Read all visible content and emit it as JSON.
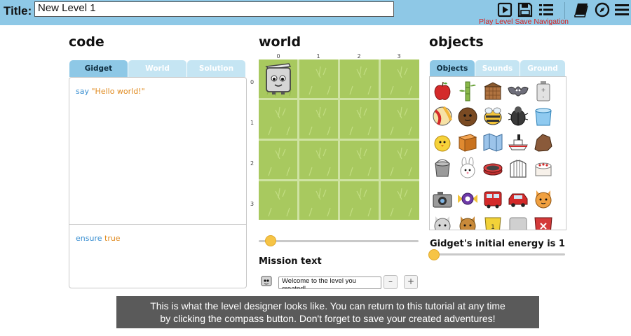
{
  "toolbar": {
    "title_label": "Title:",
    "title_value": "New Level 1",
    "play_label": "Play Level",
    "save_label": "Save",
    "navigation_label": "Navigation",
    "accent": "#8ec8e6",
    "label_color": "#d81e1e",
    "icons": [
      "play-icon",
      "save-icon",
      "list-icon",
      "book-icon",
      "compass-icon",
      "menu-icon"
    ]
  },
  "code": {
    "heading": "code",
    "tabs": [
      {
        "label": "Gidget",
        "active": true
      },
      {
        "label": "World",
        "active": false
      },
      {
        "label": "Solution",
        "active": false
      }
    ],
    "line1_kw": "say",
    "line1_str": "\"Hello world!\"",
    "ensure_kw": "ensure",
    "ensure_val": "true"
  },
  "world": {
    "heading": "world",
    "col_labels": [
      "0",
      "1",
      "2",
      "3"
    ],
    "row_labels": [
      "0",
      "1",
      "2",
      "3"
    ],
    "slider_value": 0.05,
    "mission_title": "Mission text",
    "mission_value": "Welcome to the level you created!",
    "minus": "–",
    "plus": "+"
  },
  "objects": {
    "heading": "objects",
    "tabs": [
      {
        "label": "Objects",
        "active": true
      },
      {
        "label": "Sounds",
        "active": false
      },
      {
        "label": "Ground",
        "active": false
      }
    ],
    "items": [
      "apple",
      "bamboo",
      "basket",
      "bat",
      "battery",
      "ball",
      "coconut",
      "bee",
      "beetle",
      "bucket",
      "chick",
      "box",
      "map",
      "boat",
      "rock",
      "pail",
      "bunny",
      "drum",
      "cage",
      "cake",
      "camera",
      "candy",
      "bus",
      "car",
      "cat",
      "cat-grey",
      "cat-orange",
      "bin-yellow",
      "block-grey",
      "bin-red"
    ],
    "energy_label": "Gidget's initial energy is 1",
    "energy_slider_value": 0.0
  },
  "tutorial": {
    "line1": "This is what the level designer looks like. You can return to this tutorial at any time",
    "line2": "by clicking the compass button. Don't forget to save your created adventures!"
  }
}
